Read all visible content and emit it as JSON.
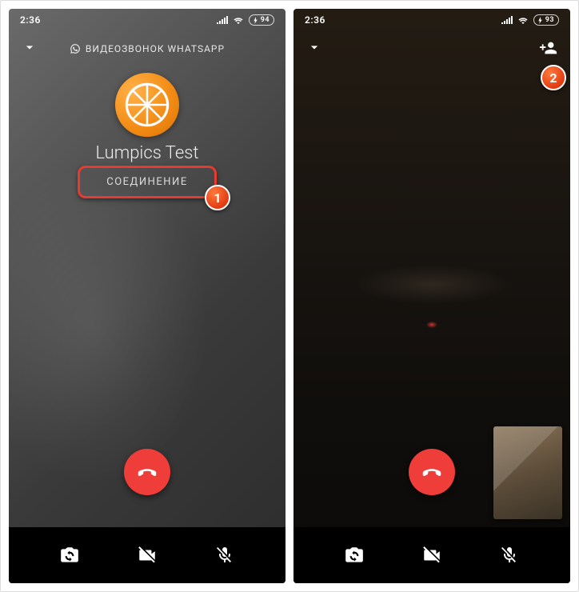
{
  "left": {
    "status": {
      "time": "2:36",
      "battery": "94"
    },
    "header": {
      "title": "ВИДЕОЗВОНОК WHATSAPP"
    },
    "contact": "Lumpics Test",
    "call_status": "СОЕДИНЕНИЕ"
  },
  "right": {
    "status": {
      "time": "2:36",
      "battery": "93"
    }
  },
  "icons": {
    "minimize": "chevron-down-icon",
    "whatsapp": "whatsapp-icon",
    "add_participant": "add-person-icon",
    "end_call": "end-call-icon",
    "switch_camera": "switch-camera-icon",
    "video_off": "video-off-icon",
    "mic_off": "mic-off-icon",
    "signal": "signal-icon",
    "wifi": "wifi-icon",
    "battery": "battery-icon"
  },
  "annotations": {
    "one": "1",
    "two": "2"
  },
  "colors": {
    "endcall": "#ef3e3a",
    "highlight": "#e63b2e",
    "accent": "#f28a12"
  }
}
